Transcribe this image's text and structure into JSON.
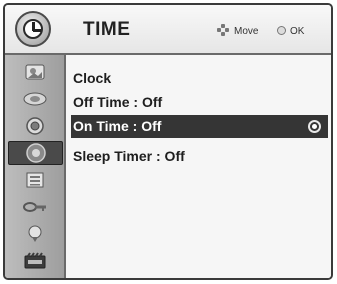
{
  "header": {
    "title": "TIME",
    "move_label": "Move",
    "ok_label": "OK"
  },
  "sidebar": {
    "items": [
      {
        "name": "picture-icon",
        "selected": false
      },
      {
        "name": "audio-icon",
        "selected": false
      },
      {
        "name": "setup-icon",
        "selected": false
      },
      {
        "name": "time-icon",
        "selected": true
      },
      {
        "name": "option-icon",
        "selected": false
      },
      {
        "name": "lock-icon",
        "selected": false
      },
      {
        "name": "input-icon",
        "selected": false
      },
      {
        "name": "usb-icon",
        "selected": false
      }
    ]
  },
  "menu": {
    "items": [
      {
        "label": "Clock",
        "selected": false
      },
      {
        "label": "Off Time : Off",
        "selected": false
      },
      {
        "label": "On Time : Off",
        "selected": true
      },
      {
        "label": "Sleep Timer : Off",
        "selected": false
      }
    ]
  },
  "colors": {
    "highlight": "#353535",
    "sidebar": "#a8a8a8",
    "background": "#f6f6f6"
  }
}
